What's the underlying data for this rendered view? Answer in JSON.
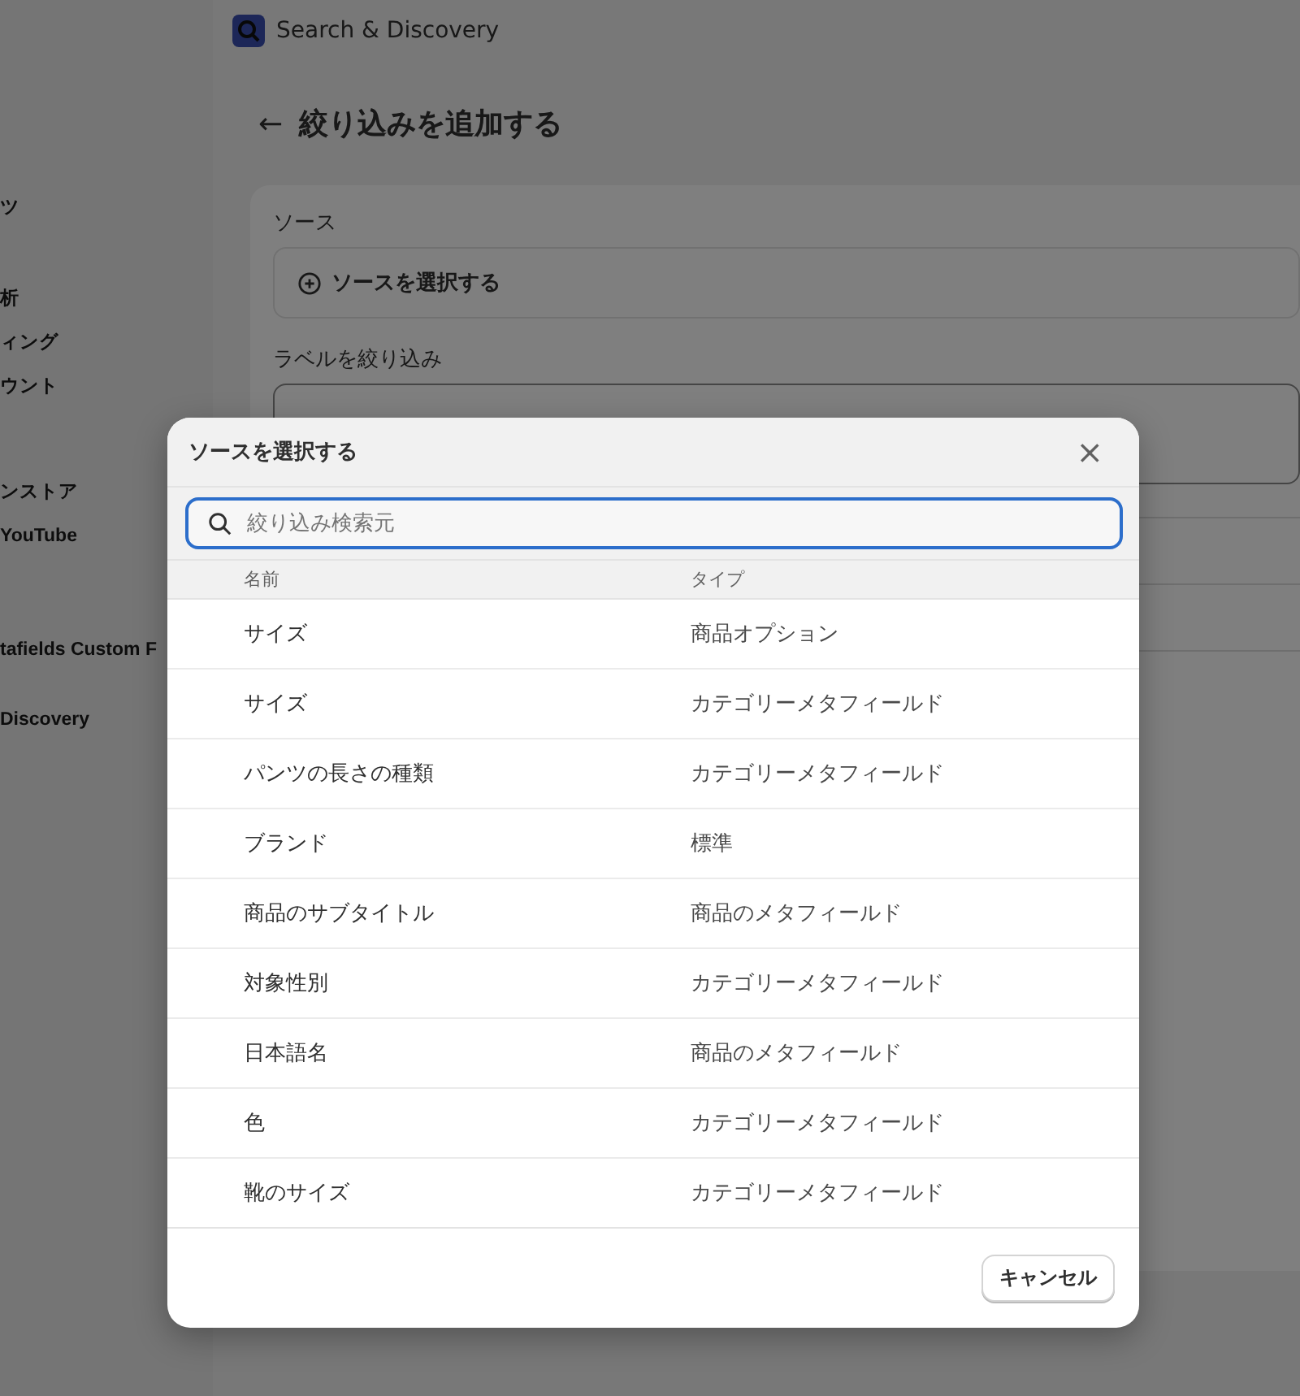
{
  "app": {
    "title": "Search & Discovery"
  },
  "sidebar": {
    "items": [
      {
        "label": "ツ"
      },
      {
        "label": "析"
      },
      {
        "label": "ィング"
      },
      {
        "label": "ウント"
      },
      {
        "label": "ンストア"
      },
      {
        "label": " YouTube"
      },
      {
        "label": "tafields Custom F"
      },
      {
        "label": " Discovery"
      }
    ]
  },
  "page": {
    "back": "←",
    "title": "絞り込みを追加する",
    "source_label": "ソース",
    "source_button": "ソースを選択する",
    "filter_label": "ラベルを絞り込み"
  },
  "modal": {
    "title": "ソースを選択する",
    "close": "×",
    "search": {
      "placeholder": "絞り込み検索元"
    },
    "columns": [
      "名前",
      "タイプ"
    ],
    "rows": [
      {
        "name": "サイズ",
        "type": "商品オプション"
      },
      {
        "name": "サイズ",
        "type": "カテゴリーメタフィールド"
      },
      {
        "name": "パンツの長さの種類",
        "type": "カテゴリーメタフィールド"
      },
      {
        "name": "ブランド",
        "type": "標準"
      },
      {
        "name": "商品のサブタイトル",
        "type": "商品のメタフィールド"
      },
      {
        "name": "対象性別",
        "type": "カテゴリーメタフィールド"
      },
      {
        "name": "日本語名",
        "type": "商品のメタフィールド"
      },
      {
        "name": "色",
        "type": "カテゴリーメタフィールド"
      },
      {
        "name": "靴のサイズ",
        "type": "カテゴリーメタフィールド"
      }
    ],
    "cancel": "キャンセル"
  }
}
